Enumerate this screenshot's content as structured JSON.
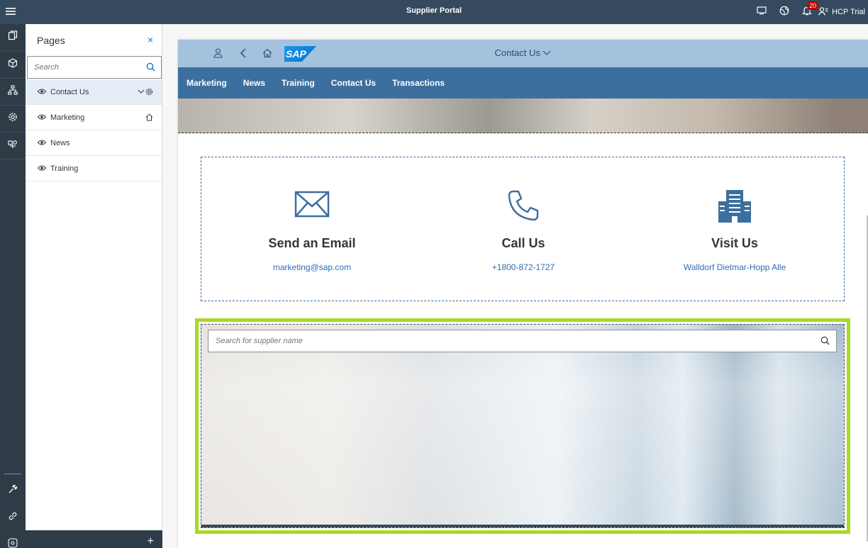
{
  "shell": {
    "title": "Supplier Portal",
    "notification_count": "20",
    "user": "HCP Trial"
  },
  "pages_panel": {
    "title": "Pages",
    "close_symbol": "×",
    "search_placeholder": "Search",
    "items": [
      {
        "label": "Contact Us",
        "selected": true
      },
      {
        "label": "Marketing",
        "home": true
      },
      {
        "label": "News"
      },
      {
        "label": "Training"
      }
    ],
    "add_symbol": "+"
  },
  "site": {
    "page_name": "Contact Us",
    "logo_text": "SAP",
    "nav": [
      "Marketing",
      "News",
      "Training",
      "Contact Us",
      "Transactions"
    ],
    "contact": [
      {
        "icon": "envelope-icon",
        "heading": "Send an Email",
        "value": "marketing@sap.com"
      },
      {
        "icon": "phone-icon",
        "heading": "Call Us",
        "value": "+1800-872-1727"
      },
      {
        "icon": "building-icon",
        "heading": "Visit Us",
        "value": "Walldorf Dietmar-Hopp Alle"
      }
    ],
    "supplier_search_placeholder": "Search for supplier name"
  },
  "colors": {
    "shell": "#354a5f",
    "rail": "#2f3c48",
    "site_topbar": "#a4c1de",
    "site_nav": "#3d6f9e",
    "icon_blue": "#3d6f9e",
    "link_blue": "#2e6db4",
    "selection_highlight": "#a8d92a"
  }
}
